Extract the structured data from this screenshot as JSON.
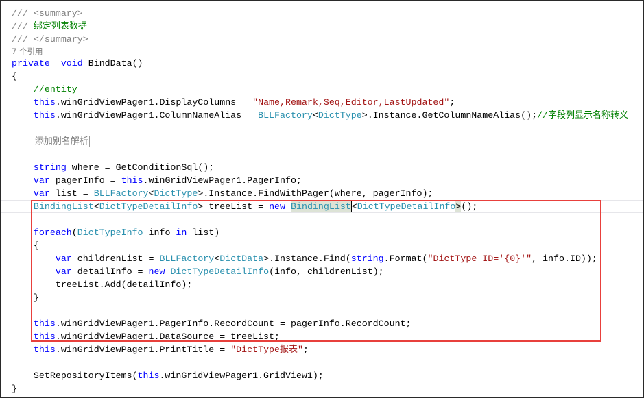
{
  "editor": {
    "highlight_color": "#e8403c",
    "lines": [
      {
        "indent": 0,
        "tokens": [
          [
            "doc",
            "/// <summary>"
          ]
        ]
      },
      {
        "indent": 0,
        "tokens": [
          [
            "doc",
            "/// "
          ],
          [
            "cm cjk",
            "绑定列表数据"
          ]
        ]
      },
      {
        "indent": 0,
        "tokens": [
          [
            "doc",
            "/// </summary>"
          ]
        ]
      },
      {
        "indent": 0,
        "kind": "lens",
        "tokens": [
          [
            "lens",
            "7 个引用"
          ]
        ]
      },
      {
        "indent": 0,
        "tokens": [
          [
            "kw",
            "private"
          ],
          [
            "",
            "  "
          ],
          [
            "kw",
            "void"
          ],
          [
            "",
            " BindData()"
          ]
        ]
      },
      {
        "indent": 0,
        "tokens": [
          [
            "",
            "{"
          ]
        ]
      },
      {
        "indent": 1,
        "tokens": [
          [
            "cm",
            "//entity"
          ]
        ]
      },
      {
        "indent": 1,
        "tokens": [
          [
            "kw",
            "this"
          ],
          [
            "",
            ".winGridViewPager1.DisplayColumns = "
          ],
          [
            "str",
            "\"Name,Remark,Seq,Editor,LastUpdated\""
          ],
          [
            "",
            ";"
          ]
        ]
      },
      {
        "indent": 1,
        "tokens": [
          [
            "kw",
            "this"
          ],
          [
            "",
            ".winGridViewPager1.ColumnNameAlias = "
          ],
          [
            "type",
            "BLLFactory"
          ],
          [
            "",
            "<"
          ],
          [
            "type",
            "DictType"
          ],
          [
            "",
            ">.Instance.GetColumnNameAlias();"
          ],
          [
            "cm",
            "//"
          ],
          [
            "cm cjk",
            "字段列显示名称转义"
          ]
        ]
      },
      {
        "indent": 0,
        "tokens": []
      },
      {
        "indent": 1,
        "tokens": [
          [
            "collapsed",
            "添加别名解析"
          ]
        ]
      },
      {
        "indent": 0,
        "tokens": []
      },
      {
        "indent": 1,
        "tokens": [
          [
            "kw",
            "string"
          ],
          [
            "",
            " where = GetConditionSql();"
          ]
        ]
      },
      {
        "indent": 1,
        "tokens": [
          [
            "kw",
            "var"
          ],
          [
            "",
            " pagerInfo = "
          ],
          [
            "kw",
            "this"
          ],
          [
            "",
            ".winGridViewPager1.PagerInfo;"
          ]
        ]
      },
      {
        "indent": 1,
        "tokens": [
          [
            "kw",
            "var"
          ],
          [
            "",
            " list = "
          ],
          [
            "type",
            "BLLFactory"
          ],
          [
            "",
            "<"
          ],
          [
            "type",
            "DictType"
          ],
          [
            "",
            ">.Instance.FindWithPager(where, pagerInfo);"
          ]
        ]
      },
      {
        "indent": 1,
        "kind": "current",
        "tokens": [
          [
            "type",
            "BindingList"
          ],
          [
            "",
            "<"
          ],
          [
            "type",
            "DictTypeDetailInfo"
          ],
          [
            "",
            "> treeList = "
          ],
          [
            "kw",
            "new"
          ],
          [
            "",
            " "
          ],
          [
            "type hl",
            "BindingList"
          ],
          [
            "caret",
            "<"
          ],
          [
            "type",
            "DictTypeDetailInfo"
          ],
          [
            "hl",
            ">"
          ],
          [
            "",
            "();"
          ]
        ]
      },
      {
        "indent": 0,
        "tokens": []
      },
      {
        "indent": 1,
        "tokens": [
          [
            "kw",
            "foreach"
          ],
          [
            "",
            "("
          ],
          [
            "type",
            "DictTypeInfo"
          ],
          [
            "",
            " info "
          ],
          [
            "kw",
            "in"
          ],
          [
            "",
            " list)"
          ]
        ]
      },
      {
        "indent": 1,
        "tokens": [
          [
            "",
            "{"
          ]
        ]
      },
      {
        "indent": 2,
        "tokens": [
          [
            "kw",
            "var"
          ],
          [
            "",
            " childrenList = "
          ],
          [
            "type",
            "BLLFactory"
          ],
          [
            "",
            "<"
          ],
          [
            "type",
            "DictData"
          ],
          [
            "",
            ">.Instance.Find("
          ],
          [
            "kw",
            "string"
          ],
          [
            "",
            ".Format("
          ],
          [
            "str",
            "\"DictType_ID='{0}'\""
          ],
          [
            "",
            ", info.ID));"
          ]
        ]
      },
      {
        "indent": 2,
        "tokens": [
          [
            "kw",
            "var"
          ],
          [
            "",
            " detailInfo = "
          ],
          [
            "kw",
            "new"
          ],
          [
            "",
            " "
          ],
          [
            "type",
            "DictTypeDetailInfo"
          ],
          [
            "",
            "(info, childrenList);"
          ]
        ]
      },
      {
        "indent": 2,
        "tokens": [
          [
            "",
            "treeList.Add(detailInfo);"
          ]
        ]
      },
      {
        "indent": 1,
        "tokens": [
          [
            "",
            "}"
          ]
        ]
      },
      {
        "indent": 0,
        "tokens": []
      },
      {
        "indent": 1,
        "tokens": [
          [
            "kw",
            "this"
          ],
          [
            "",
            ".winGridViewPager1.PagerInfo.RecordCount = pagerInfo.RecordCount;"
          ]
        ]
      },
      {
        "indent": 1,
        "tokens": [
          [
            "kw",
            "this"
          ],
          [
            "",
            ".winGridViewPager1.DataSource = treeList;"
          ]
        ]
      },
      {
        "indent": 1,
        "tokens": [
          [
            "kw",
            "this"
          ],
          [
            "",
            ".winGridViewPager1.PrintTitle = "
          ],
          [
            "str",
            "\"DictType"
          ],
          [
            "str cjk",
            "报表"
          ],
          [
            "str",
            "\""
          ],
          [
            "",
            ";"
          ]
        ]
      },
      {
        "indent": 0,
        "tokens": []
      },
      {
        "indent": 1,
        "tokens": [
          [
            "",
            "SetRepositoryItems("
          ],
          [
            "kw",
            "this"
          ],
          [
            "",
            ".winGridViewPager1.GridView1);"
          ]
        ]
      },
      {
        "indent": 0,
        "tokens": [
          [
            "",
            "}"
          ]
        ]
      }
    ]
  }
}
